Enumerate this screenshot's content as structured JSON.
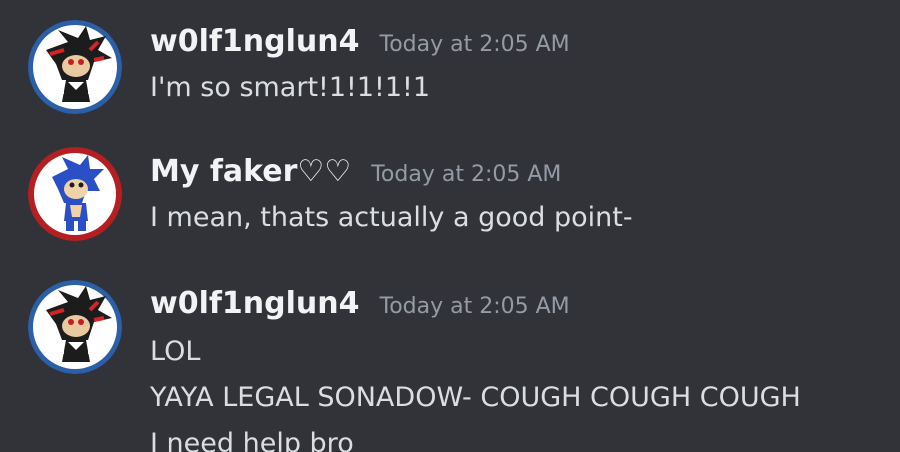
{
  "colors": {
    "background": "#313338",
    "username": "#f2f3f5",
    "timestamp": "#949ba4",
    "message_text": "#dbdee1",
    "shadow_avatar_ring": "#2b5fa8",
    "sonic_avatar_ring": "#b51f22"
  },
  "messages": [
    {
      "avatar_icon": "shadow-hedgehog-avatar",
      "username": "w0lf1nglun4",
      "timestamp": "Today at 2:05 AM",
      "lines": [
        "I'm so smart!1!1!1!1"
      ]
    },
    {
      "avatar_icon": "sonic-hedgehog-avatar",
      "username": "My faker♡♡",
      "timestamp": "Today at 2:05 AM",
      "lines": [
        "I mean, thats actually a good point-"
      ]
    },
    {
      "avatar_icon": "shadow-hedgehog-avatar",
      "username": "w0lf1nglun4",
      "timestamp": "Today at 2:05 AM",
      "lines": [
        "LOL",
        "YAYA LEGAL SONADOW- COUGH COUGH COUGH",
        "I need help bro"
      ]
    }
  ]
}
